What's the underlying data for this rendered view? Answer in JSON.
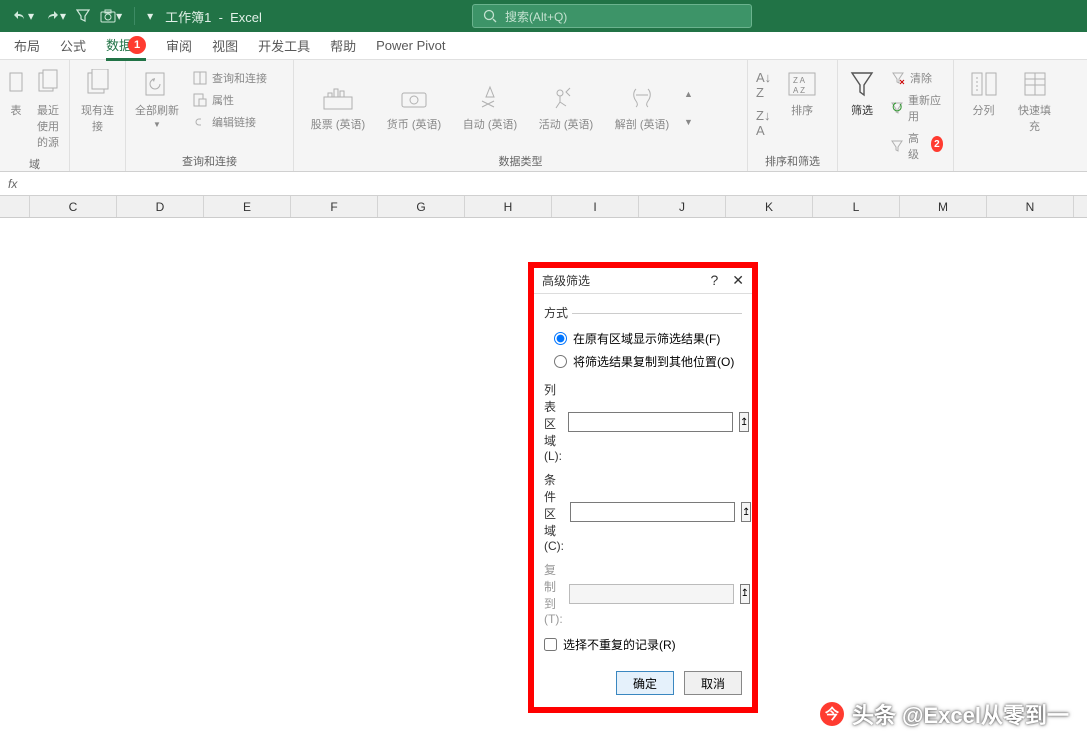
{
  "titlebar": {
    "doc_name": "工作簿1",
    "app_name": "Excel",
    "search_placeholder": "搜索(Alt+Q)"
  },
  "tabs": {
    "layout": "布局",
    "formulas": "公式",
    "data": "数据",
    "review": "审阅",
    "view": "视图",
    "dev": "开发工具",
    "help": "帮助",
    "powerpivot": "Power Pivot"
  },
  "annotations": {
    "badge1": "1",
    "badge2": "2"
  },
  "ribbon": {
    "g1": {
      "btn1": "表",
      "btn2": "最近使用的源",
      "label": "域"
    },
    "g2": {
      "btn1": "现有连接"
    },
    "g3": {
      "btn1": "全部刷新",
      "s1": "查询和连接",
      "s2": "属性",
      "s3": "编辑链接",
      "label": "查询和连接"
    },
    "g4": {
      "b1": "股票 (英语)",
      "b2": "货币 (英语)",
      "b3": "自动 (英语)",
      "b4": "活动 (英语)",
      "b5": "解剖 (英语)",
      "more": "▼",
      "label": "数据类型"
    },
    "g5": {
      "b1": "排序",
      "label": "排序和筛选"
    },
    "g6": {
      "b1": "筛选",
      "s1": "清除",
      "s2": "重新应用",
      "s3": "高级"
    },
    "g7": {
      "b1": "分列",
      "b2": "快速填充"
    }
  },
  "fx": {
    "label": "fx"
  },
  "cols": [
    "",
    "C",
    "D",
    "E",
    "F",
    "G",
    "H",
    "I",
    "J",
    "K",
    "L",
    "M",
    "N"
  ],
  "dialog": {
    "title": "高级筛选",
    "method": "方式",
    "radio1": "在原有区域显示筛选结果(F)",
    "radio2": "将筛选结果复制到其他位置(O)",
    "list_range": "列表区域(L):",
    "crit_range": "条件区域(C):",
    "copy_to": "复制到(T):",
    "unique": "选择不重复的记录(R)",
    "ok": "确定",
    "cancel": "取消"
  },
  "watermark": {
    "text": "头条 @Excel从零到一"
  }
}
